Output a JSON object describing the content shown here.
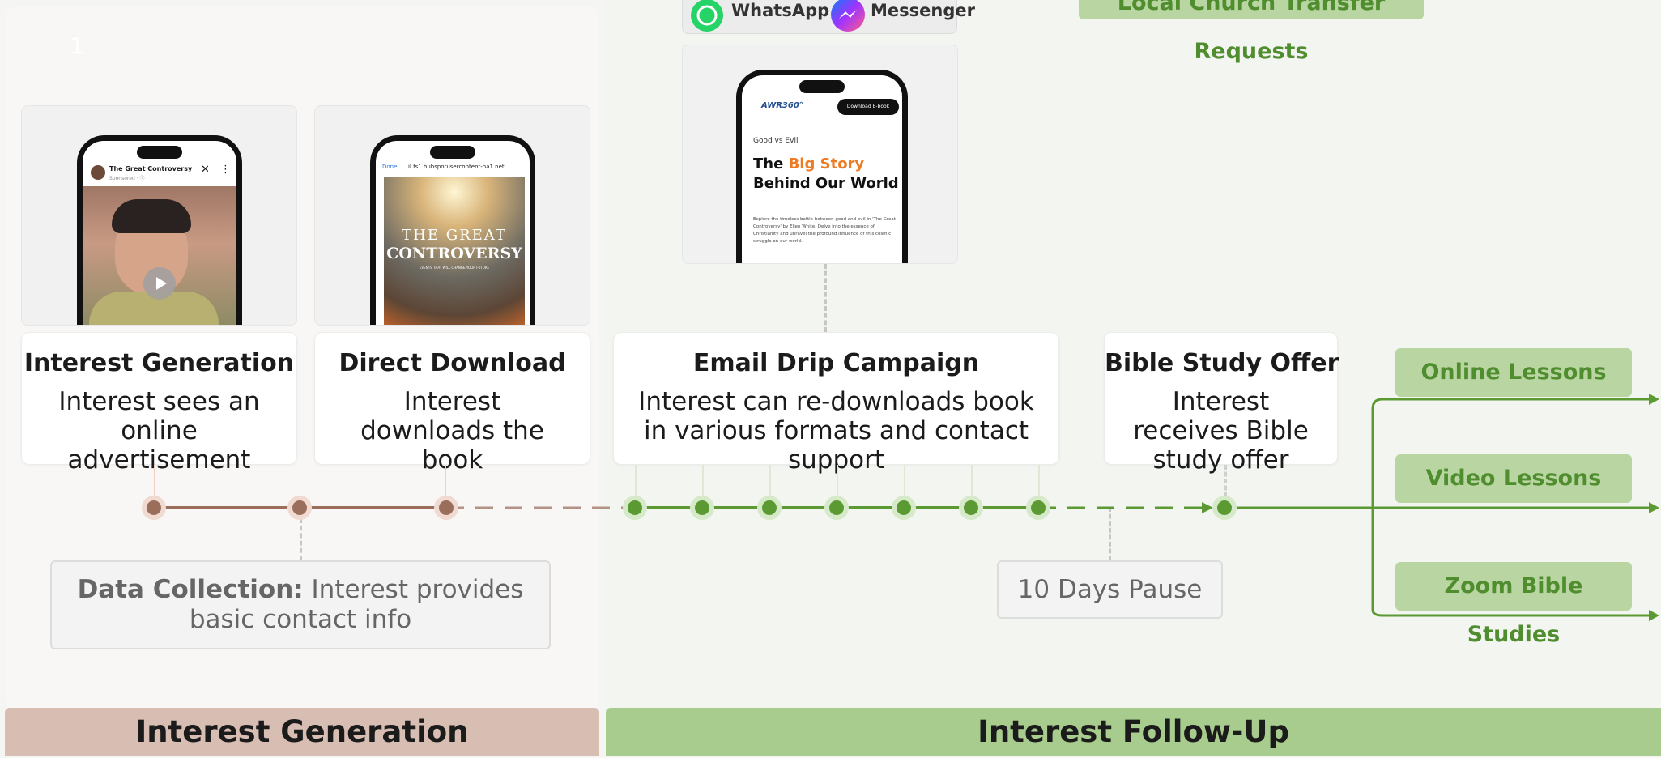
{
  "step_number": "1",
  "messaging": {
    "whatsapp": "WhatsApp",
    "messenger": "Messenger"
  },
  "top_tag": "Local Church Transfer Requests",
  "phone_ad": {
    "title": "The Great Controversy",
    "subtitle": "Sponsored · ⓘ"
  },
  "phone_download": {
    "done": "Done",
    "url": "il.fs1.hubspotusercontent-na1.net",
    "book_line1": "THE GREAT",
    "book_line2": "CONTROVERSY",
    "book_tagline": "EVENTS THAT WILL CHANGE YOUR FUTURE"
  },
  "phone_email": {
    "logo": "AWR360°",
    "button": "Download E-book",
    "kicker": "Good vs Evil",
    "headline_1": "The ",
    "headline_highlight": "Big Story",
    "headline_2": "Behind Our World",
    "body": "Explore the timeless battle between good and evil in 'The Great Controversy' by Ellen White. Delve into the essence of Christianity and unravel the profound influence of this cosmic struggle on our world."
  },
  "cards": [
    {
      "title": "Interest Generation",
      "desc": "Interest sees an online advertisement"
    },
    {
      "title": "Direct Download",
      "desc": "Interest downloads the book"
    },
    {
      "title": "Email Drip Campaign",
      "desc": "Interest can re-downloads book in various formats and contact support"
    },
    {
      "title": "Bible Study Offer",
      "desc": "Interest receives Bible study offer"
    }
  ],
  "data_collection": {
    "label": "Data Collection:",
    "text": " Interest provides basic contact info"
  },
  "pause_note": "10 Days Pause",
  "options": [
    "Online Lessons",
    "Video Lessons",
    "Zoom Bible Studies"
  ],
  "footers": {
    "left": "Interest Generation",
    "right": "Interest Follow-Up"
  },
  "colors": {
    "brown": "#9a6e5a",
    "green": "#5b9a32",
    "tag_bg": "#b9d6a2",
    "left_footer": "#d8bdb3",
    "right_footer": "#a8cc8d",
    "highlight": "#ee7a22"
  }
}
